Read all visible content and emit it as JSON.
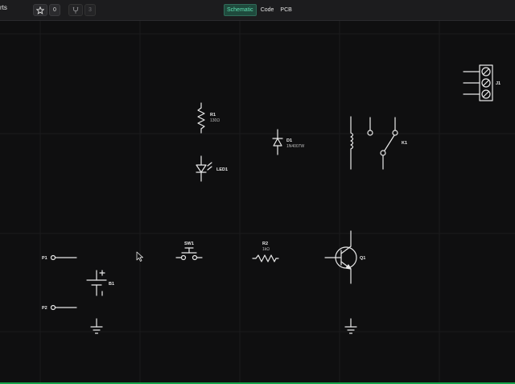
{
  "header": {
    "title": "rts",
    "star_count": "0",
    "fork_count": "3",
    "tabs": [
      {
        "label": "Schematic",
        "active": true
      },
      {
        "label": "Code",
        "active": false
      },
      {
        "label": "PCB",
        "active": false
      }
    ]
  },
  "schematic": {
    "components": {
      "r1": {
        "ref": "R1",
        "value": "130Ω"
      },
      "led1": {
        "ref": "LED1"
      },
      "d1": {
        "ref": "D1",
        "value": "1N4007W"
      },
      "k1": {
        "ref": "K1"
      },
      "j1": {
        "ref": "J1"
      },
      "p1": {
        "ref": "P1"
      },
      "p2": {
        "ref": "P2"
      },
      "b1": {
        "ref": "B1"
      },
      "sw1": {
        "ref": "SW1"
      },
      "r2": {
        "ref": "R2",
        "value": "1kΩ"
      },
      "q1": {
        "ref": "Q1"
      }
    }
  },
  "colors": {
    "background": "#0f0f10",
    "toolbar": "#1c1c1e",
    "accent": "#5fe0b2",
    "wire": "#e8e8e8",
    "status_bar": "#16a34a"
  }
}
